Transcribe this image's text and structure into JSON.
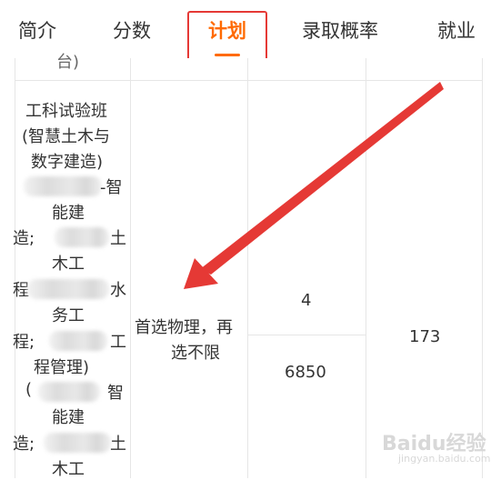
{
  "tabs": [
    {
      "label": "简介",
      "active": false
    },
    {
      "label": "分数",
      "active": false
    },
    {
      "label": "计划",
      "active": true
    },
    {
      "label": "录取概率",
      "active": false
    },
    {
      "label": "就业",
      "active": false
    }
  ],
  "colors": {
    "accent": "#ff6a00",
    "annotation": "#e53935"
  },
  "table": {
    "top_partial": "台)",
    "major_lines": [
      "工科试验班",
      "(智慧土木与",
      "数字建造)",
      "-智",
      "能建",
      "造;",
      "土",
      "木工",
      "程",
      "水",
      "务工",
      "程;",
      "工",
      "程管理)",
      "(",
      "智",
      "能建",
      "造;",
      "土",
      "木工"
    ],
    "subject_requirement": [
      "首选物理，再",
      "选不限"
    ],
    "plan_count": "4",
    "tuition": "6850",
    "total": "173"
  },
  "watermark": {
    "brand": "Baidu经验",
    "url": "jingyan.baidu.com"
  }
}
